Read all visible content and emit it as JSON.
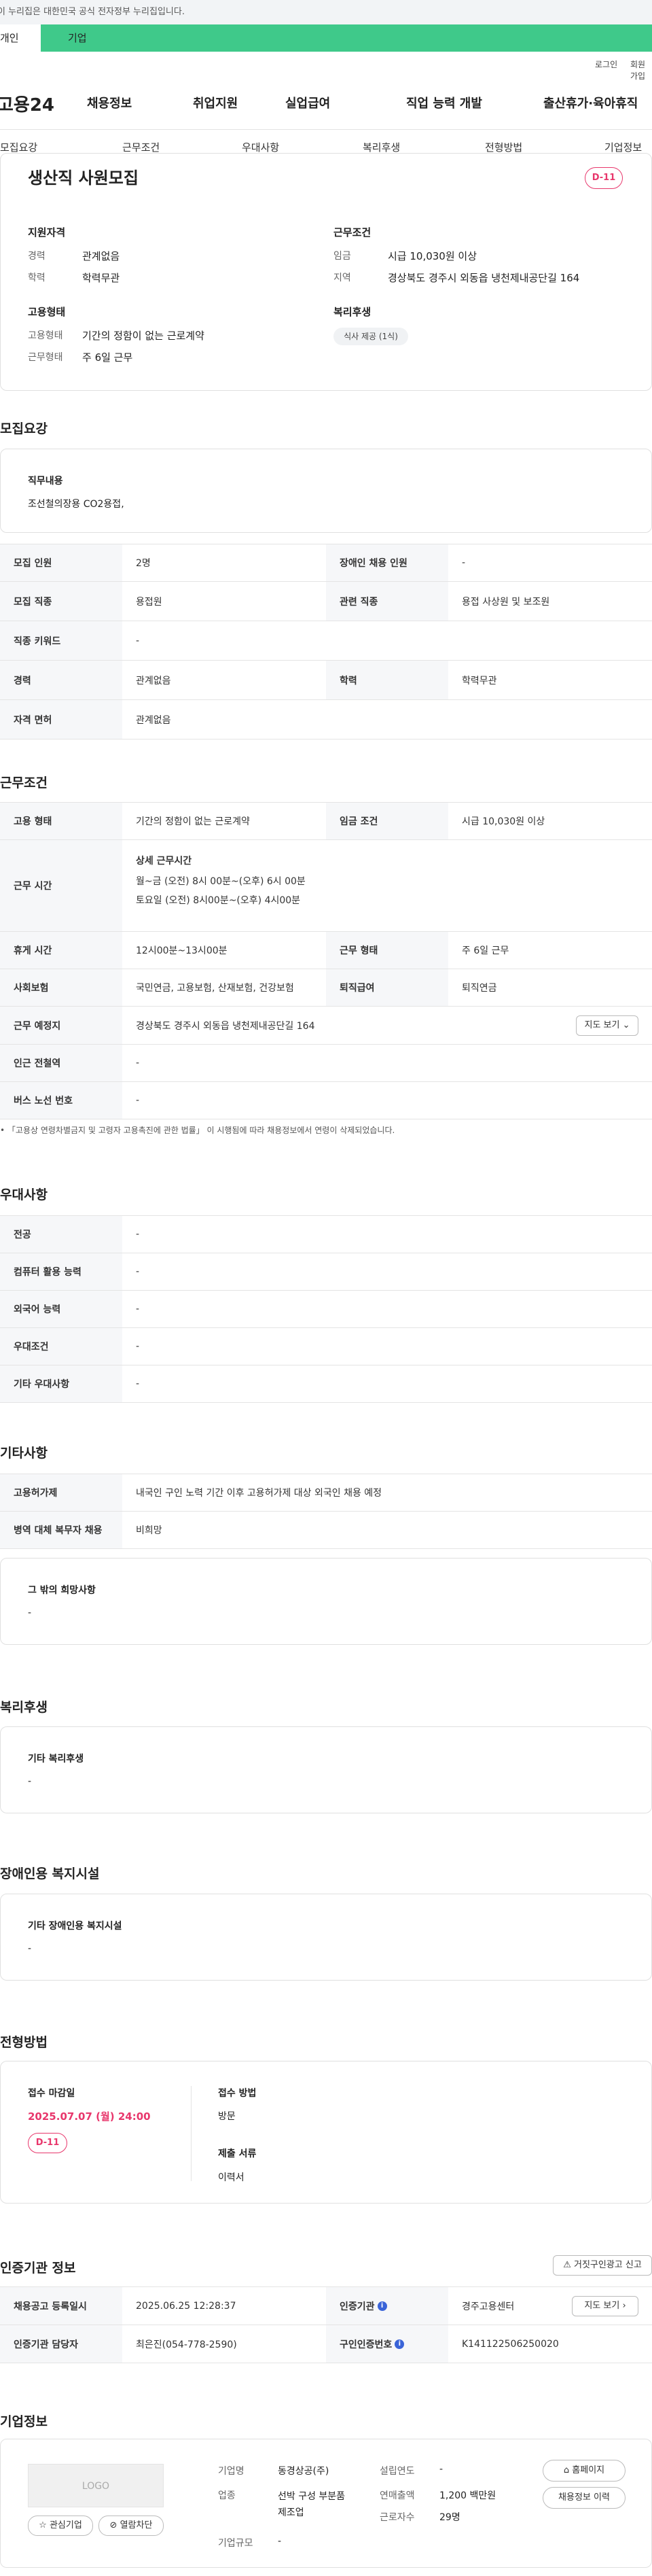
{
  "gov_banner": "이 누리집은 대한민국 공식 전자정부 누리집입니다.",
  "top_tabs": [
    "개인",
    "기업"
  ],
  "utility": [
    "로그인",
    "회원가입"
  ],
  "brand": "고용24",
  "main_nav": [
    "채용정보",
    "취업지원",
    "실업급여",
    "직업 능력 개발",
    "출산휴가·육아휴직"
  ],
  "tabs": [
    "모집요강",
    "근무조건",
    "우대사항",
    "복리후생",
    "전형방법",
    "기업정보"
  ],
  "summary": {
    "title": "생산직 사원모집",
    "dday": "D-11",
    "qual_title": "지원자격",
    "career_label": "경력",
    "career_value": "관계없음",
    "edu_label": "학력",
    "edu_value": "학력무관",
    "cond_title": "근무조건",
    "wage_label": "임금",
    "wage_value": "시급 10,030원 이상",
    "area_label": "지역",
    "area_value": "경상북도 경주시 외동읍 냉천제내공단길 164",
    "emp_title": "고용형태",
    "emp_label": "고용형태",
    "emp_value": "기간의 정함이 없는 근로계약",
    "work_label": "근무형태",
    "work_value": "주 6일 근무",
    "welfare_title": "복리후생",
    "welfare_chip": "식사 제공 (1식)"
  },
  "recruit": {
    "title": "모집요강",
    "duty_title": "직무내용",
    "duty_text": "조선철의장용 CO2용접,",
    "rows": [
      {
        "th": "모집 인원",
        "td": "2명",
        "th2": "장애인 채용 인원",
        "td2": "-"
      },
      {
        "th": "모집 직종",
        "td": "용접원",
        "th2": "관련 직종",
        "td2": "용접 사상원 및 보조원"
      },
      {
        "th": "직종 키워드",
        "td": "-"
      },
      {
        "th": "경력",
        "td": "관계없음",
        "th2": "학력",
        "td2": "학력무관"
      },
      {
        "th": "자격 면허",
        "td": "관계없음"
      }
    ]
  },
  "work": {
    "title": "근무조건",
    "r1": {
      "th": "고용 형태",
      "td": "기간의 정함이 없는 근로계약",
      "th2": "임금 조건",
      "td2": "시급 10,030원 이상"
    },
    "hours_th": "근무 시간",
    "hours_title": "상세 근무시간",
    "hours_l1": "월~금 (오전) 8시 00분~(오후) 6시 00분",
    "hours_l2": "토요일 (오전) 8시00분~(오후) 4시00분",
    "r3": {
      "th": "휴게 시간",
      "td": "12시00분~13시00분",
      "th2": "근무 형태",
      "td2": "주 6일 근무"
    },
    "r4": {
      "th": "사회보험",
      "td": "국민연금, 고용보험, 산재보험, 건강보험",
      "th2": "퇴직급여",
      "td2": "퇴직연금"
    },
    "loc_th": "근무 예정지",
    "loc_td": "경상북도 경주시 외동읍 냉천제내공단길 164",
    "map_button": "지도 보기",
    "r6": {
      "th": "인근 전철역",
      "td": "-"
    },
    "r7": {
      "th": "버스 노선 번호",
      "td": "-"
    },
    "note": "「고용상 연령차별금지 및 고령자 고용촉진에 관한 법률」 이 시행됨에 따라 채용정보에서 연령이 삭제되었습니다."
  },
  "pref": {
    "title": "우대사항",
    "rows": [
      {
        "th": "전공",
        "td": "-"
      },
      {
        "th": "컴퓨터 활용 능력",
        "td": "-"
      },
      {
        "th": "외국어 능력",
        "td": "-"
      },
      {
        "th": "우대조건",
        "td": "-"
      },
      {
        "th": "기타 우대사항",
        "td": "-"
      }
    ]
  },
  "etc": {
    "title": "기타사항",
    "r1": {
      "th": "고용허가제",
      "td": "내국인 구인 노력 기간 이후 고용허가제 대상 외국인 채용 예정"
    },
    "r2": {
      "th": "병역 대체 복무자 채용",
      "td": "비희망"
    },
    "box_title": "그 밖의 희망사항",
    "box_value": "-"
  },
  "welfare": {
    "title": "복리후생",
    "box_title": "기타 복리후생",
    "box_value": "-"
  },
  "disab": {
    "title": "장애인용 복지시설",
    "box_title": "기타 장애인용 복지시설",
    "box_value": "-"
  },
  "process": {
    "title": "전형방법",
    "deadline_label": "접수 마감일",
    "deadline": "2025.07.07 (월) 24:00",
    "dday": "D-11",
    "method_label": "접수 방법",
    "method": "방문",
    "docs_label": "제출 서류",
    "docs": "이력서"
  },
  "agency": {
    "title": "인증기관 정보",
    "report_button": "거짓구인광고 신고",
    "r1": {
      "th": "채용공고 등록일시",
      "td": "2025.06.25 12:28:37",
      "th2": "인증기관",
      "td2": "경주고용센터"
    },
    "map_button": "지도 보기",
    "r2": {
      "th": "인증기관 담당자",
      "td": "최은진(054-778-2590)",
      "th2": "구인인증번호",
      "td2": "K141122506250020"
    },
    "info_glyph": "i"
  },
  "company": {
    "title": "기업정보",
    "logo_text": "LOGO",
    "fav_button": "관심기업",
    "block_button": "열람차단",
    "name_label": "기업명",
    "name": "동경상공(주)",
    "biz_label": "업종",
    "biz": "선박 구성 부분품 제조업",
    "scale_label": "기업규모",
    "scale": "-",
    "founded_label": "설립연도",
    "founded": "-",
    "sales_label": "연매출액",
    "sales": "1,200 백만원",
    "staff_label": "근로자수",
    "staff": "29명",
    "home_button": "홈페이지",
    "history_button": "채용정보 이력"
  }
}
